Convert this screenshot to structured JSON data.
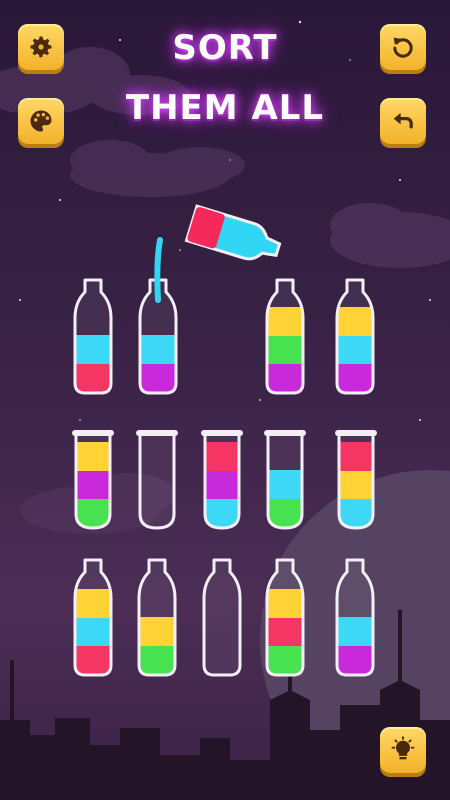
{
  "title": {
    "line1": "SORT",
    "line2": "THEM ALL"
  },
  "buttons": {
    "settings": "gear-icon",
    "restart": "restart-icon",
    "palette": "palette-icon",
    "undo": "undo-icon",
    "hint": "lightbulb-icon"
  },
  "colors": {
    "red": "#f5295a",
    "pink": "#ff2d6f",
    "blue": "#31d6f5",
    "purple": "#c51cd9",
    "yellow": "#ffd02a",
    "green": "#3de045",
    "button": "#f3b22a"
  },
  "containers": [
    {
      "type": "bottle",
      "row": 1,
      "segments": [
        "blue",
        "red"
      ],
      "empty": true
    },
    {
      "type": "bottle",
      "row": 1,
      "segments": [
        "blue",
        "purple"
      ],
      "receiving": true
    },
    {
      "type": "bottle",
      "row": 1,
      "segments": [
        "yellow",
        "green",
        "purple"
      ]
    },
    {
      "type": "bottle",
      "row": 1,
      "segments": [
        "yellow",
        "blue",
        "purple"
      ]
    },
    {
      "type": "tube",
      "row": 2,
      "segments": [
        "yellow",
        "purple",
        "green"
      ]
    },
    {
      "type": "tube",
      "row": 2,
      "segments": []
    },
    {
      "type": "tube",
      "row": 2,
      "segments": [
        "red",
        "purple",
        "blue"
      ]
    },
    {
      "type": "tube",
      "row": 2,
      "segments": [
        "blue",
        "green"
      ]
    },
    {
      "type": "tube",
      "row": 2,
      "segments": [
        "red",
        "yellow",
        "blue"
      ]
    },
    {
      "type": "bottle",
      "row": 3,
      "segments": [
        "yellow",
        "blue",
        "red"
      ]
    },
    {
      "type": "bottle",
      "row": 3,
      "segments": [
        "yellow",
        "green"
      ]
    },
    {
      "type": "bottle",
      "row": 3,
      "segments": []
    },
    {
      "type": "bottle",
      "row": 3,
      "segments": [
        "yellow",
        "red",
        "green"
      ]
    },
    {
      "type": "bottle",
      "row": 3,
      "segments": [
        "blue",
        "purple"
      ]
    }
  ],
  "pouring_bottle": {
    "color": "red",
    "stream_color": "blue"
  }
}
